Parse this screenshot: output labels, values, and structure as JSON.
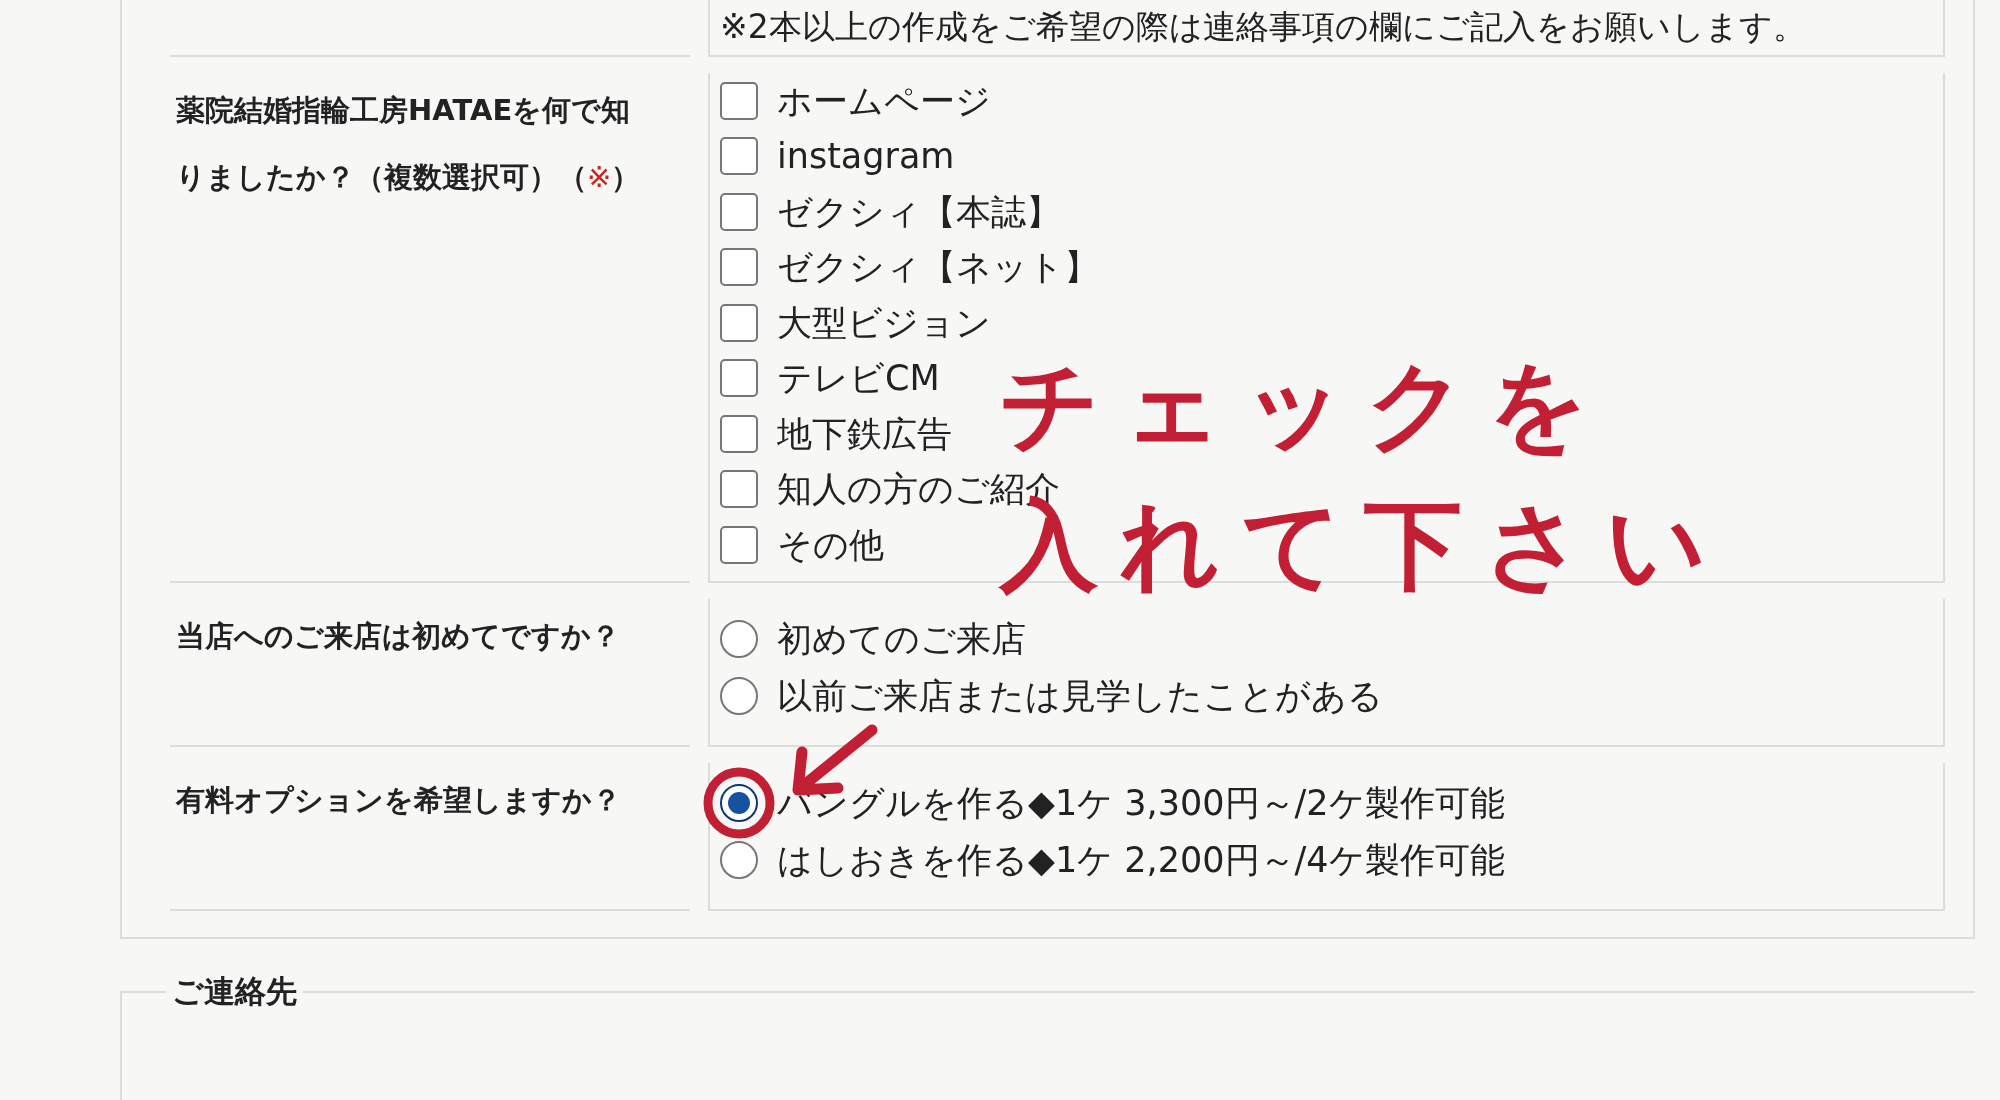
{
  "form_rows": [
    {
      "kind": "note",
      "note": "※2本以上の作成をご希望の際は連絡事項の欄にご記入をお願いします。"
    },
    {
      "kind": "checkboxes",
      "label_parts": [
        {
          "kind": "plain",
          "text": "薬院結婚指輪工房HATAEを何で知りましたか？（複数選択可）（"
        },
        {
          "kind": "required",
          "text": "※"
        },
        {
          "kind": "plain",
          "text": "）"
        }
      ],
      "options": [
        {
          "label": "ホームページ",
          "checked": false
        },
        {
          "label": "instagram",
          "checked": false
        },
        {
          "label": "ゼクシィ【本誌】",
          "checked": false
        },
        {
          "label": "ゼクシィ【ネット】",
          "checked": false
        },
        {
          "label": "大型ビジョン",
          "checked": false
        },
        {
          "label": "テレビCM",
          "checked": false
        },
        {
          "label": "地下鉄広告",
          "checked": false
        },
        {
          "label": "知人の方のご紹介",
          "checked": false
        },
        {
          "label": "その他",
          "checked": false
        }
      ]
    },
    {
      "kind": "radios",
      "label_parts": [
        {
          "kind": "plain",
          "text": "当店へのご来店は初めてですか？"
        }
      ],
      "options": [
        {
          "label": "初めてのご来店",
          "selected": false
        },
        {
          "label": "以前ご来店または見学したことがある",
          "selected": false
        }
      ]
    },
    {
      "kind": "radios",
      "label_parts": [
        {
          "kind": "plain",
          "text": "有料オプションを希望しますか？"
        }
      ],
      "options": [
        {
          "label": "バングルを作る◆1ケ 3,300円～/2ケ製作可能",
          "selected": true
        },
        {
          "label": "はしおきを作る◆1ケ 2,200円～/4ケ製作可能",
          "selected": false
        }
      ]
    }
  ],
  "next_section": {
    "legend": "ご連絡先"
  },
  "annotation": {
    "lines": [
      "チェックを",
      "入れて下さい"
    ]
  }
}
